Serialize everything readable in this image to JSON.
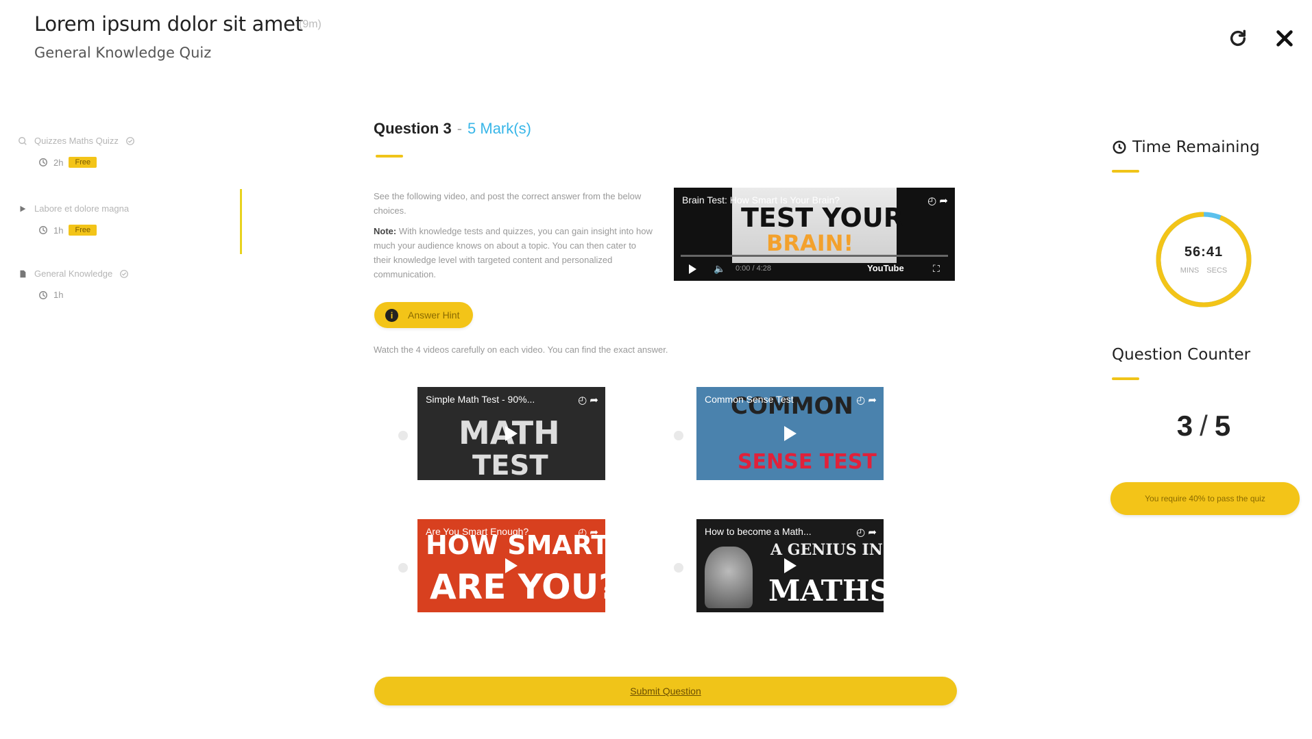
{
  "header": {
    "title": "Lorem ipsum dolor sit amet",
    "badge": "(9m)",
    "subtitle": "General Knowledge Quiz"
  },
  "sidebar": {
    "items": [
      {
        "label": "Quizzes Maths Quizz",
        "meta": "2h",
        "badge": "Free",
        "icon": "quiz-icon"
      },
      {
        "label": "Labore et dolore magna",
        "meta": "1h",
        "badge": "Free",
        "icon": "video-icon"
      },
      {
        "label": "General Knowledge",
        "meta": "1h",
        "badge": "",
        "icon": "document-icon"
      }
    ]
  },
  "question": {
    "label": "Question 3",
    "separator": "-",
    "marks": "5 Mark(s)",
    "text": "See the following video, and post the correct answer from the below choices.",
    "note_label": "Note:",
    "note": "With knowledge tests and quizzes, you can gain insight into how much your audience knows on about a topic. You can then cater to their knowledge level with targeted content and personalized communication.",
    "hint_button": "Answer Hint",
    "hint_text": "Watch the 4 videos carefully on each video. You can find the exact answer."
  },
  "main_video": {
    "title": "Brain Test: How Smart Is Your Brain?",
    "big_text_1": "TEST YOUR",
    "big_text_2": "BRAIN!",
    "time": "0:00 / 4:28",
    "brand": "YouTube"
  },
  "options": [
    {
      "title": "Simple Math Test - 90%...",
      "big_text_1": "MATH",
      "big_text_2": "TEST",
      "bg": "#2a2a2a"
    },
    {
      "title": "Common Sense Test",
      "big_text_1": "COMMON",
      "big_text_2": "SENSE TEST",
      "bg": "#4a82ad"
    },
    {
      "title": "Are You Smart Enough?",
      "big_text_1": "HOW SMART",
      "big_text_2": "ARE YOU?",
      "bg": "#d8401f"
    },
    {
      "title": "How to become a Math...",
      "big_text_1": "A GENIUS IN",
      "big_text_2": "MATHS",
      "bg": "#1a1a1a"
    }
  ],
  "submit_button": "Submit Question",
  "right_panel": {
    "time_heading": "Time Remaining",
    "time_value": "56:41",
    "time_labels": "MINS SECS",
    "time_fraction_remaining": 0.94,
    "counter_heading": "Question Counter",
    "counter_current": "3",
    "counter_total": "5",
    "counter_sep": "/",
    "pass_text": "You require 40% to pass the quiz"
  },
  "colors": {
    "accent": "#f0c419",
    "marks": "#38b6e8"
  }
}
